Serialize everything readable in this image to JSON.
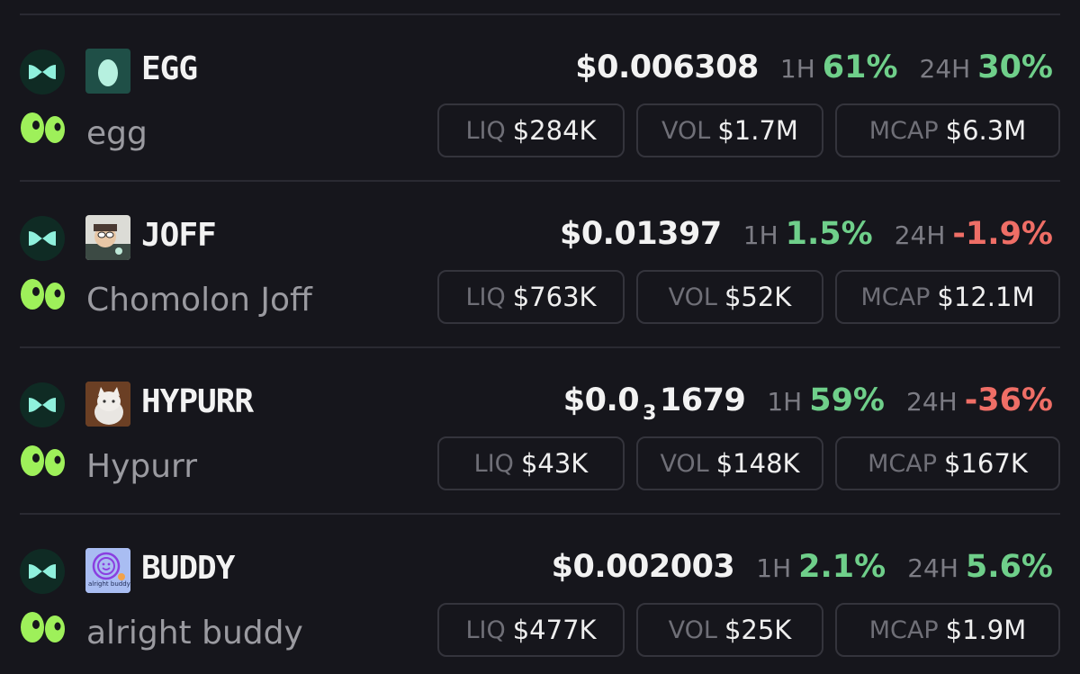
{
  "colors": {
    "background": "#16161c",
    "positive": "#6fcf8a",
    "negative": "#ef6e66",
    "chain_icon": "#8ff0dc",
    "eyes_icon": "#9ef05a"
  },
  "tokens": [
    {
      "ticker": "EGG",
      "name": "egg",
      "icon": "egg-icon",
      "price_main": "$0.006308",
      "price_sub": "",
      "price_tail": "",
      "h1_label": "1H",
      "h1_change": "61%",
      "h24_label": "24H",
      "h24_change": "30%",
      "liq_label": "LIQ",
      "liq_value": "$284K",
      "vol_label": "VOL",
      "vol_value": "$1.7M",
      "mcap_label": "MCAP",
      "mcap_value": "$6.3M"
    },
    {
      "ticker": "JOFF",
      "name": "Chomolon Joff",
      "icon": "cartoon-face-icon",
      "price_main": "$0.01397",
      "price_sub": "",
      "price_tail": "",
      "h1_label": "1H",
      "h1_change": "1.5%",
      "h24_label": "24H",
      "h24_change": "-1.9%",
      "liq_label": "LIQ",
      "liq_value": "$763K",
      "vol_label": "VOL",
      "vol_value": "$52K",
      "mcap_label": "MCAP",
      "mcap_value": "$12.1M"
    },
    {
      "ticker": "HYPURR",
      "name": "Hypurr",
      "icon": "cat-icon",
      "price_main": "$0.0",
      "price_sub": "3",
      "price_tail": "1679",
      "h1_label": "1H",
      "h1_change": "59%",
      "h24_label": "24H",
      "h24_change": "-36%",
      "liq_label": "LIQ",
      "liq_value": "$43K",
      "vol_label": "VOL",
      "vol_value": "$148K",
      "mcap_label": "MCAP",
      "mcap_value": "$167K"
    },
    {
      "ticker": "BUDDY",
      "name": "alright buddy",
      "icon": "smiley-icon",
      "logo_text": "alright buddy",
      "price_main": "$0.002003",
      "price_sub": "",
      "price_tail": "",
      "h1_label": "1H",
      "h1_change": "2.1%",
      "h24_label": "24H",
      "h24_change": "5.6%",
      "liq_label": "LIQ",
      "liq_value": "$477K",
      "vol_label": "VOL",
      "vol_value": "$25K",
      "mcap_label": "MCAP",
      "mcap_value": "$1.9M"
    }
  ]
}
